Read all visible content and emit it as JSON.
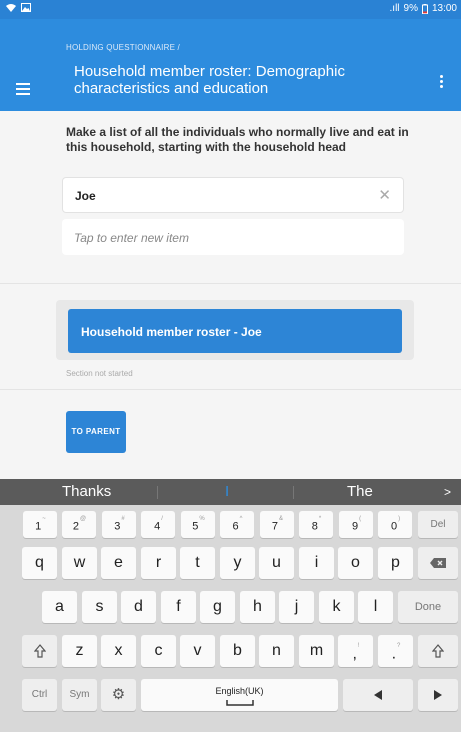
{
  "status_bar": {
    "signal_label": ".ıll",
    "battery_percent": "9%",
    "time": "13:00"
  },
  "header": {
    "breadcrumb": "HOLDING QUESTIONNAIRE /",
    "title": "Household member roster: Demographic characteristics and education"
  },
  "question": {
    "text": "Make a list of all the individuals who normally live and eat in this household, starting with the household head"
  },
  "roster": {
    "items": [
      "Joe"
    ],
    "new_item_placeholder": "Tap to enter new item"
  },
  "section": {
    "button_label": "Household member roster - Joe",
    "status": "Section not started"
  },
  "parent_button": {
    "label": "TO PARENT"
  },
  "keyboard": {
    "suggestions": [
      "Thanks",
      "I",
      "The"
    ],
    "number_row": [
      {
        "key": "1",
        "alt": "~"
      },
      {
        "key": "2",
        "alt": "@"
      },
      {
        "key": "3",
        "alt": "#"
      },
      {
        "key": "4",
        "alt": "/"
      },
      {
        "key": "5",
        "alt": "%"
      },
      {
        "key": "6",
        "alt": "^"
      },
      {
        "key": "7",
        "alt": "&"
      },
      {
        "key": "8",
        "alt": "*"
      },
      {
        "key": "9",
        "alt": "("
      },
      {
        "key": "0",
        "alt": ")"
      }
    ],
    "del_label": "Del",
    "row1": [
      "q",
      "w",
      "e",
      "r",
      "t",
      "y",
      "u",
      "i",
      "o",
      "p"
    ],
    "row2": [
      "a",
      "s",
      "d",
      "f",
      "g",
      "h",
      "j",
      "k",
      "l"
    ],
    "done_label": "Done",
    "row3": [
      "z",
      "x",
      "c",
      "v",
      "b",
      "n",
      "m"
    ],
    "comma_alt": "!",
    "period_alt": "?",
    "ctrl_label": "Ctrl",
    "sym_label": "Sym",
    "space_label": "English(UK)",
    "accent": "#2d8cde"
  }
}
